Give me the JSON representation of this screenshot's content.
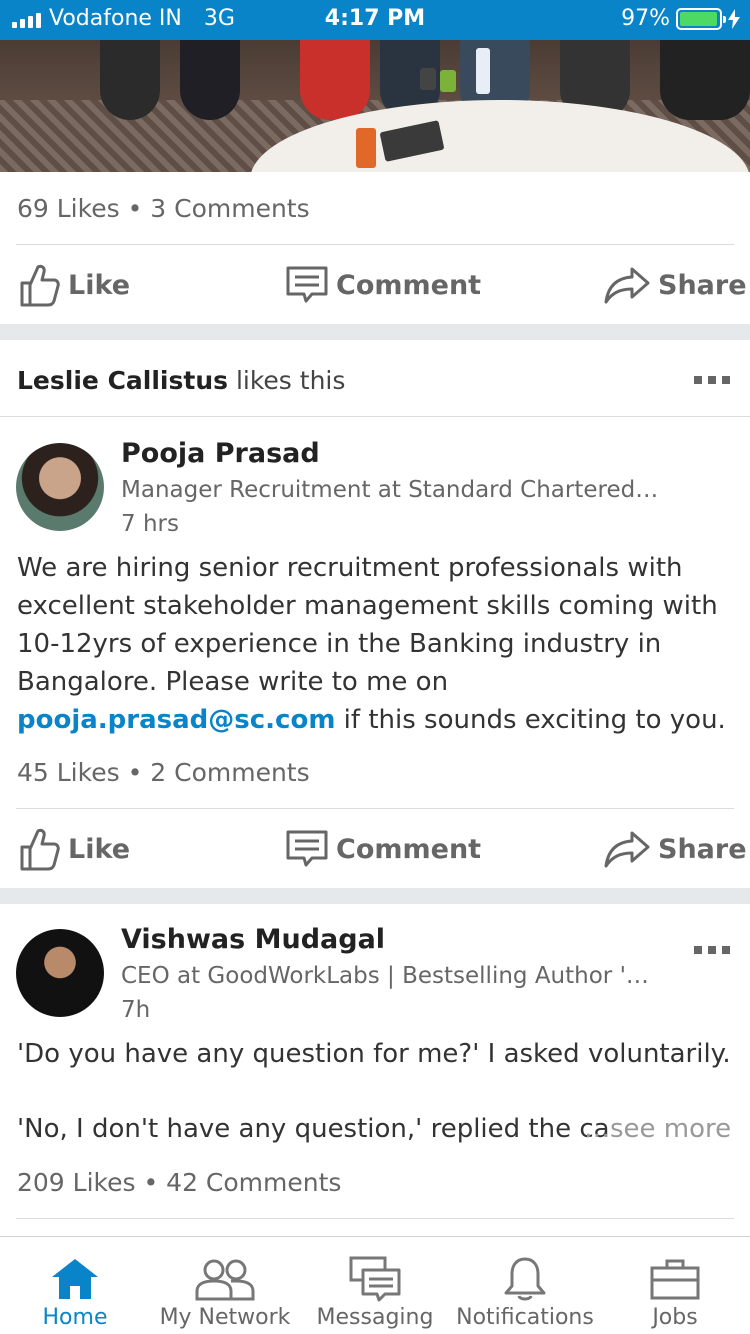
{
  "status_bar": {
    "carrier": "Vodafone IN",
    "network": "3G",
    "time": "4:17 PM",
    "battery_percent": "97%",
    "battery_level": 0.97
  },
  "post1": {
    "stats": "69 Likes • 3 Comments"
  },
  "actions": {
    "like": "Like",
    "comment": "Comment",
    "share": "Share"
  },
  "post2": {
    "liked_by": "Leslie Callistus",
    "liked_suffix": "likes this",
    "author": "Pooja Prasad",
    "headline": "Manager Recruitment at Standard Chartered Bank",
    "time": "7 hrs",
    "text_before": "We are hiring senior recruitment professionals with excellent stakeholder management skills coming with 10-12yrs of experience in the Banking industry in Bangalore. Please write to me on ",
    "email": "pooja.prasad@sc.com",
    "text_after": " if this sounds exciting to you.",
    "stats": "45 Likes • 2 Comments"
  },
  "post3": {
    "author": "Vishwas Mudagal",
    "headline": "CEO at GoodWorkLabs | Bestselling Author 'Losi…",
    "time": "7h",
    "line1": "'Do you have any question for me?' I asked voluntarily.",
    "line2": "'No, I don't have any question,' replied the ca",
    "see_more": "…see more",
    "stats": "209 Likes • 42 Comments"
  },
  "tabs": [
    {
      "label": "Home",
      "icon": "home-icon",
      "active": true
    },
    {
      "label": "My Network",
      "icon": "network-icon",
      "active": false
    },
    {
      "label": "Messaging",
      "icon": "messaging-icon",
      "active": false
    },
    {
      "label": "Notifications",
      "icon": "bell-icon",
      "active": false
    },
    {
      "label": "Jobs",
      "icon": "briefcase-icon",
      "active": false
    }
  ],
  "colors": {
    "brand": "#0a84c8",
    "battery": "#4cd964",
    "gap": "#e6e9ec"
  }
}
